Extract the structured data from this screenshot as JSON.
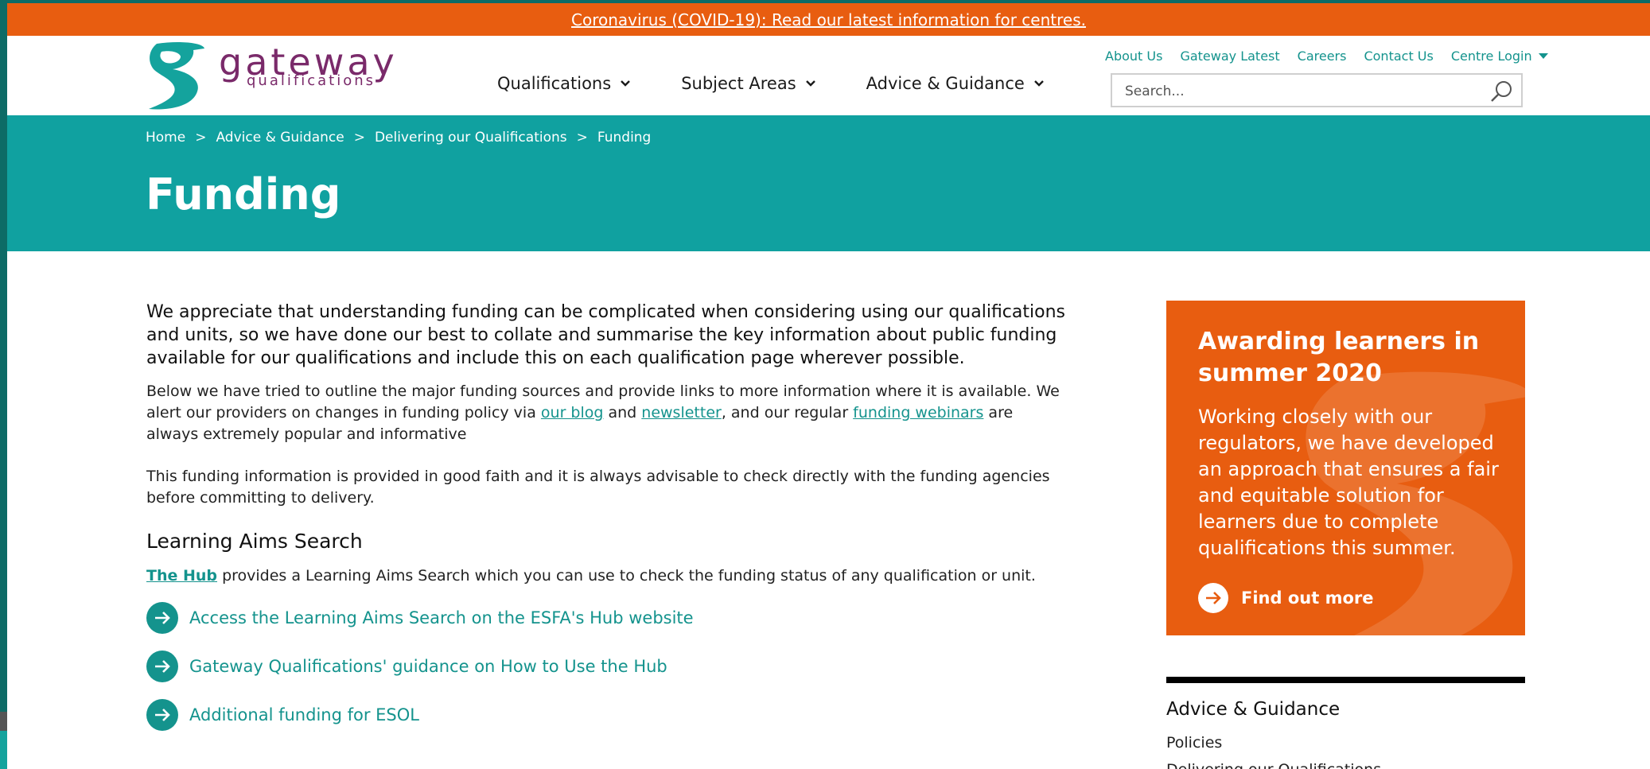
{
  "banner": {
    "text": "Coronavirus (COVID-19): Read our latest information for centres."
  },
  "logo": {
    "word": "gateway",
    "sub": "qualifications"
  },
  "nav": {
    "main": [
      {
        "label": "Qualifications"
      },
      {
        "label": "Subject Areas"
      },
      {
        "label": "Advice & Guidance"
      }
    ],
    "utility": [
      "About Us",
      "Gateway Latest",
      "Careers",
      "Contact Us"
    ],
    "login_label": "Centre Login"
  },
  "search": {
    "placeholder": "Search..."
  },
  "breadcrumb": [
    "Home",
    "Advice & Guidance",
    "Delivering our Qualifications",
    "Funding"
  ],
  "breadcrumb_sep": ">",
  "page": {
    "title": "Funding"
  },
  "content": {
    "lead": "We appreciate that understanding funding can be complicated when considering using our qualifications and units, so we have done our best to collate and summarise the key information about public funding available for our qualifications and include this on each qualification page wherever possible.",
    "p1_a": "Below we have tried to outline the major funding sources and provide links to more information where it is available. We alert our providers on changes in funding policy via ",
    "p1_link1": "our blog",
    "p1_b": " and ",
    "p1_link2": "newsletter",
    "p1_c": ", and our regular ",
    "p1_link3": "funding webinars",
    "p1_d": " are always extremely popular and informative",
    "p2": "This funding information is provided in good faith and it is always advisable to check directly with the funding agencies before committing to delivery.",
    "h2": "Learning Aims Search",
    "hub_link": "The Hub",
    "hub_text": " provides a Learning Aims Search which you can use to check the funding status of any qualification or unit.",
    "links": [
      "Access the Learning Aims Search on the ESFA's Hub website",
      "Gateway Qualifications' guidance on How to Use the Hub",
      "Additional funding for ESOL"
    ]
  },
  "promo": {
    "title": "Awarding learners in summer 2020",
    "body": "Working closely with our regulators, we have developed an approach that ensures a fair and equitable solution for learners due to complete qualifications this summer.",
    "link": "Find out more"
  },
  "sidebar": {
    "title": "Advice & Guidance",
    "items": [
      "Policies",
      "Delivering our Qualifications"
    ]
  },
  "colors": {
    "brand_teal": "#10a1a0",
    "brand_orange": "#e85d10",
    "brand_purple": "#7a2a6a",
    "link_teal": "#14938d"
  }
}
